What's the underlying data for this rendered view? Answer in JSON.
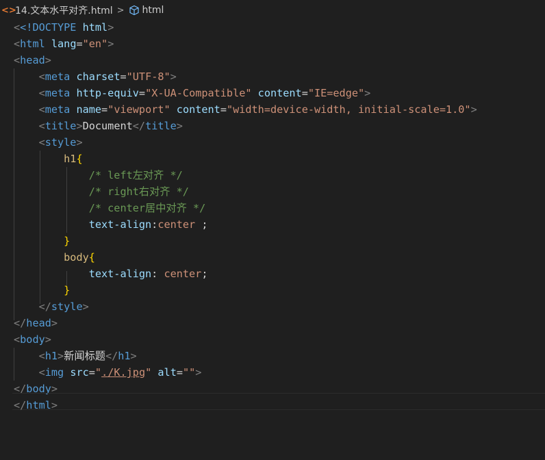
{
  "breadcrumb": {
    "file": "14.文本水平对齐.html",
    "element": "html"
  },
  "code": {
    "l1": "<!DOCTYPE",
    "l1b": "html",
    "l2_tag": "html",
    "l2_attr": "lang",
    "l2_val": "\"en\"",
    "l3_tag": "head",
    "meta": "meta",
    "charset": "charset",
    "charset_val": "\"UTF-8\"",
    "http_equiv": "http-equiv",
    "http_equiv_val": "\"X-UA-Compatible\"",
    "content": "content",
    "content_val1": "\"IE=edge\"",
    "name": "name",
    "name_val": "\"viewport\"",
    "content_val2": "\"width=device-width, initial-scale=1.0\"",
    "title_tag": "title",
    "title_text": "Document",
    "style_tag": "style",
    "sel_h1": "h1",
    "c1": "/* left左对齐 */",
    "c2": "/* right右对齐 */",
    "c3": "/* center居中对齐 */",
    "prop1": "text-align",
    "val1": "center",
    "sel_body": "body",
    "prop2": "text-align",
    "val2": "center",
    "body_tag": "body",
    "h1_tag": "h1",
    "h1_text": "新闻标题",
    "img_tag": "img",
    "src": "src",
    "src_val": "./K.jpg",
    "alt": "alt",
    "alt_val": "\"\""
  }
}
